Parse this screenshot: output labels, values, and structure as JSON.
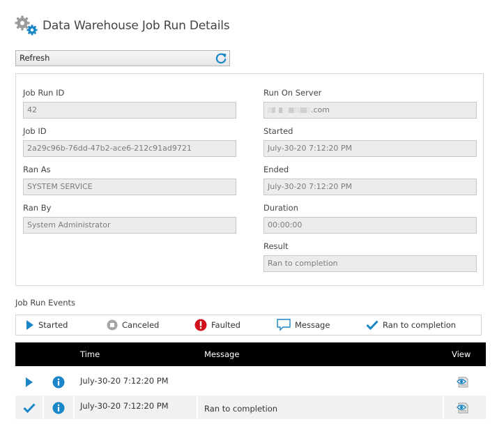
{
  "header": {
    "title": "Data Warehouse Job Run Details",
    "icon": "gears-icon"
  },
  "toolbar": {
    "refresh_label": "Refresh",
    "refresh_icon": "refresh-icon",
    "accent_color": "#1a86c8"
  },
  "details": {
    "left": [
      {
        "label": "Job Run ID",
        "value": "42"
      },
      {
        "label": "Job ID",
        "value": "2a29c96b-76dd-47b2-ace6-212c91ad9721"
      },
      {
        "label": "Ran As",
        "value": "SYSTEM SERVICE"
      },
      {
        "label": "Ran By",
        "value": "System Administrator"
      }
    ],
    "right": [
      {
        "label": "Run On Server",
        "value": ".com"
      },
      {
        "label": "Started",
        "value": "July-30-20 7:12:20 PM"
      },
      {
        "label": "Ended",
        "value": "July-30-20 7:12:20 PM"
      },
      {
        "label": "Duration",
        "value": "00:00:00"
      },
      {
        "label": "Result",
        "value": "Ran to completion"
      }
    ]
  },
  "events": {
    "title": "Job Run Events",
    "legend": [
      {
        "label": "Started",
        "icon": "play-icon"
      },
      {
        "label": "Canceled",
        "icon": "stop-icon"
      },
      {
        "label": "Faulted",
        "icon": "error-icon"
      },
      {
        "label": "Message",
        "icon": "message-icon"
      },
      {
        "label": "Ran to completion",
        "icon": "checkmark-icon"
      }
    ],
    "columns": {
      "time": "Time",
      "message": "Message",
      "view": "View"
    },
    "rows": [
      {
        "status_icon": "play-icon",
        "info_icon": "info-icon",
        "time": "July-30-20 7:12:20 PM",
        "message": "",
        "view_icon": "view-details-icon"
      },
      {
        "status_icon": "checkmark-icon",
        "info_icon": "info-icon",
        "time": "July-30-20 7:12:20 PM",
        "message": "Ran to completion",
        "view_icon": "view-details-icon"
      }
    ]
  }
}
